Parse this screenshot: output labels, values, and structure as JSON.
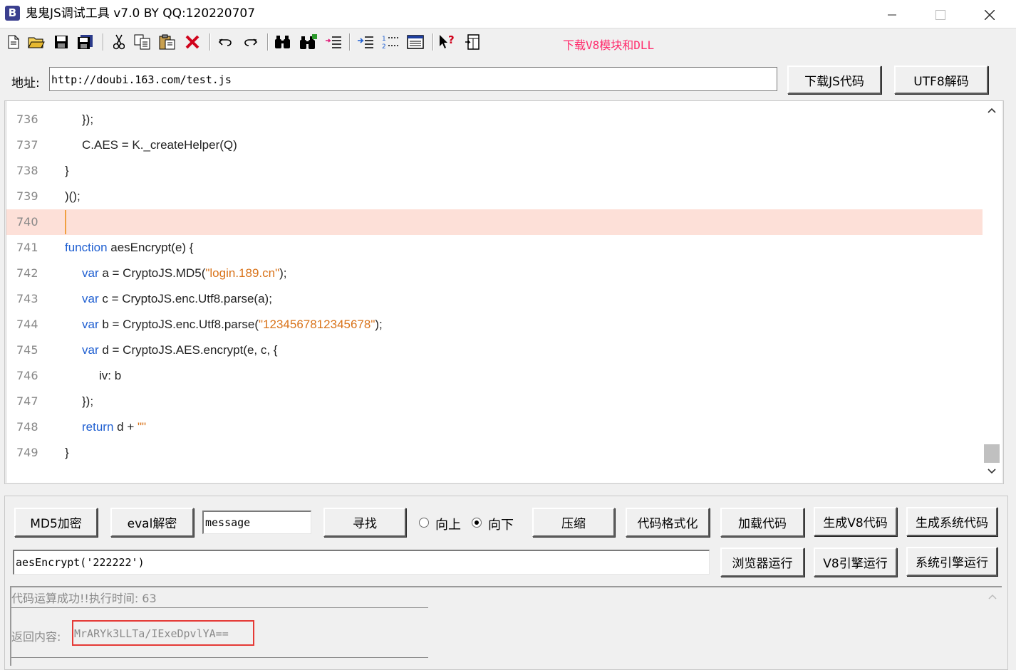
{
  "window": {
    "icon_letter": "B",
    "title": "鬼鬼JS调试工具 v7.0 BY QQ:120220707"
  },
  "toolbar": {
    "download_link": "下载V8模块和DLL",
    "icons": [
      "new-file-icon",
      "open-folder-icon",
      "save-icon",
      "save-all-icon",
      "cut-icon",
      "copy-icon",
      "paste-icon",
      "delete-icon",
      "undo-icon",
      "redo-icon",
      "find-icon",
      "find-next-icon",
      "replace-icon",
      "indent-icon",
      "line-numbers-icon",
      "window-icon",
      "help-pointer-icon",
      "split-view-icon"
    ]
  },
  "address": {
    "label": "地址:",
    "value": "http://doubi.163.com/test.js",
    "download_button": "下载JS代码",
    "utf8_button": "UTF8解码"
  },
  "editor": {
    "lines": [
      {
        "num": "736",
        "indent": 1,
        "parts": [
          [
            "t",
            "});"
          ]
        ]
      },
      {
        "num": "737",
        "indent": 1,
        "parts": [
          [
            "t",
            "C.AES = K._createHelper(Q)"
          ]
        ]
      },
      {
        "num": "738",
        "indent": 0,
        "parts": [
          [
            "t",
            "}"
          ]
        ]
      },
      {
        "num": "739",
        "indent": 0,
        "parts": [
          [
            "t",
            ")();"
          ]
        ]
      },
      {
        "num": "740",
        "indent": 0,
        "parts": [],
        "active": true
      },
      {
        "num": "741",
        "indent": 0,
        "parts": [
          [
            "k",
            "function"
          ],
          [
            "t",
            " aesEncrypt(e) {"
          ]
        ]
      },
      {
        "num": "742",
        "indent": 1,
        "parts": [
          [
            "k",
            "var"
          ],
          [
            "t",
            " a = CryptoJS.MD5("
          ],
          [
            "s",
            "\"login.189.cn\""
          ],
          [
            "t",
            ");"
          ]
        ]
      },
      {
        "num": "743",
        "indent": 1,
        "parts": [
          [
            "k",
            "var"
          ],
          [
            "t",
            " c = CryptoJS.enc.Utf8.parse(a);"
          ]
        ]
      },
      {
        "num": "744",
        "indent": 1,
        "parts": [
          [
            "k",
            "var"
          ],
          [
            "t",
            " b = CryptoJS.enc.Utf8.parse("
          ],
          [
            "s",
            "\"1234567812345678\""
          ],
          [
            "t",
            ");"
          ]
        ]
      },
      {
        "num": "745",
        "indent": 1,
        "parts": [
          [
            "k",
            "var"
          ],
          [
            "t",
            " d = CryptoJS.AES.encrypt(e, c, {"
          ]
        ]
      },
      {
        "num": "746",
        "indent": 2,
        "parts": [
          [
            "t",
            "iv: b"
          ]
        ]
      },
      {
        "num": "747",
        "indent": 1,
        "parts": [
          [
            "t",
            "});"
          ]
        ]
      },
      {
        "num": "748",
        "indent": 1,
        "parts": [
          [
            "k",
            "return"
          ],
          [
            "t",
            " d + "
          ],
          [
            "s",
            "\"\""
          ]
        ]
      },
      {
        "num": "749",
        "indent": 0,
        "parts": [
          [
            "t",
            "}"
          ]
        ]
      }
    ]
  },
  "controls": {
    "md5_button": "MD5加密",
    "eval_button": "eval解密",
    "search_value": "message",
    "find_button": "寻找",
    "radio_up": "向上",
    "radio_down": "向下",
    "compress_button": "压缩",
    "format_button": "代码格式化",
    "load_button": "加载代码",
    "gen_v8_button": "生成V8代码",
    "gen_sys_button": "生成系统代码",
    "expr_value": "aesEncrypt('222222')",
    "browser_run_button": "浏览器运行",
    "v8_run_button": "V8引擎运行",
    "sys_run_button": "系统引擎运行"
  },
  "output": {
    "status": "代码运算成功!!执行时间: 63",
    "result_label": "返回内容:",
    "result_value": "MrARYk3LLTa/IExeDpvlYA=="
  },
  "colors": {
    "keyword": "#1f5fd1",
    "string": "#d9731a",
    "active_line": "#fde0d8",
    "download_link": "#ff2d6e",
    "highlight_box": "#e53935"
  }
}
